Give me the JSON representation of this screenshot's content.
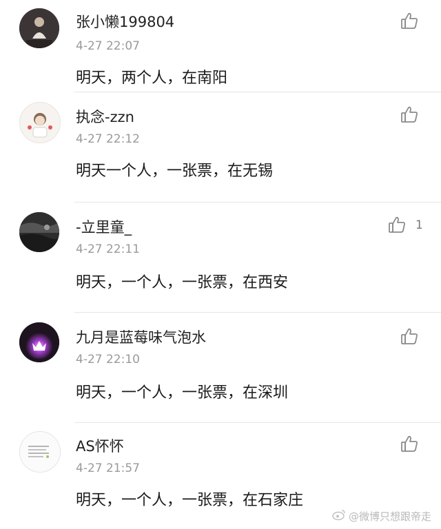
{
  "comments": [
    {
      "username": "张小懒199804",
      "timestamp": "4-27 22:07",
      "text": "明天，两个人，在南阳",
      "like_count": "",
      "like_icon": "thumbs-up-icon"
    },
    {
      "username": "执念-zzn",
      "timestamp": "4-27 22:12",
      "text": "明天一个人，一张票，在无锡",
      "like_count": "",
      "like_icon": "thumbs-up-icon"
    },
    {
      "username": "-立里童_",
      "timestamp": "4-27 22:11",
      "text": "明天，一个人，一张票，在西安",
      "like_count": "1",
      "like_icon": "thumbs-up-icon"
    },
    {
      "username": "九月是蓝莓味气泡水",
      "timestamp": "4-27 22:10",
      "text": "明天，一个人，一张票，在深圳",
      "like_count": "",
      "like_icon": "thumbs-up-icon"
    },
    {
      "username": "AS怀怀",
      "timestamp": "4-27 21:57",
      "text": "明天，一个人，一张票，在石家庄",
      "like_count": "",
      "like_icon": "thumbs-up-icon"
    }
  ],
  "watermark": {
    "text": "@微博只想跟帝走",
    "icon": "weibo-logo-icon"
  },
  "colors": {
    "username": "#222222",
    "timestamp": "#9a9a9a",
    "body_text": "#1a1a1a",
    "divider": "#e6e6e6",
    "icon": "#8a8a8a"
  }
}
